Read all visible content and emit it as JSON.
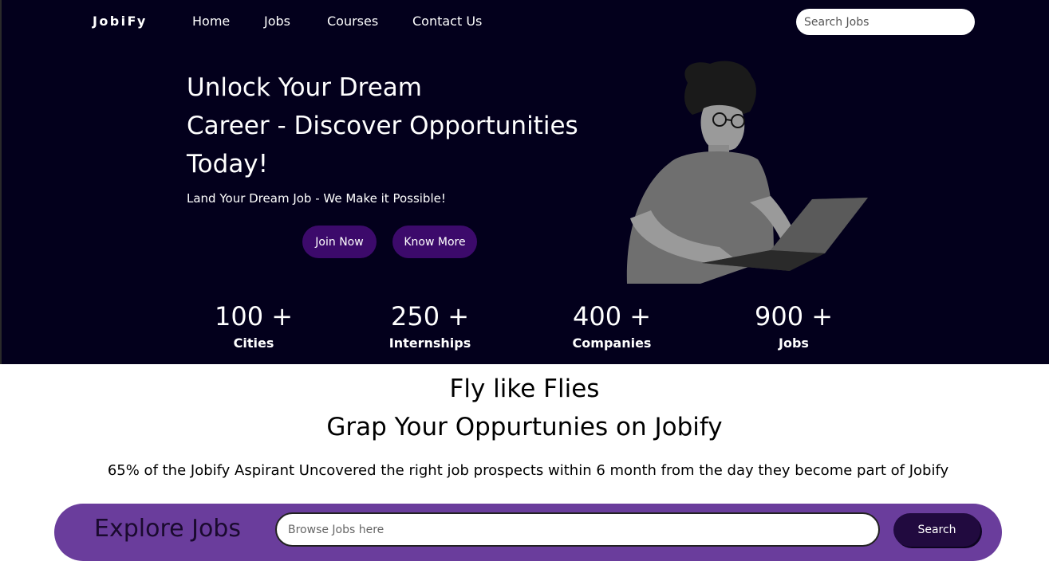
{
  "nav": {
    "logo": "JobiFy",
    "links": [
      "Home",
      "Jobs",
      "Courses",
      "Contact Us"
    ],
    "search_placeholder": "Search Jobs"
  },
  "hero": {
    "title_lines": [
      "Unlock Your Dream",
      "Career - Discover Opportunities",
      "Today!"
    ],
    "subtitle": "Land Your Dream Job - We Make it Possible!",
    "join_label": "Join Now",
    "know_label": "Know More"
  },
  "stats": [
    {
      "number": "100 +",
      "label": "Cities"
    },
    {
      "number": "250 +",
      "label": "Internships"
    },
    {
      "number": "400 +",
      "label": "Companies"
    },
    {
      "number": "900 +",
      "label": "Jobs"
    }
  ],
  "about": {
    "line1": "Fly like Flies",
    "line2": "Grap Your Oppurtunies on Jobify",
    "stat_text": "65% of the Jobify Aspirant Uncovered the right job prospects within 6 month from the day they become part of Jobify"
  },
  "explore": {
    "title": "Explore Jobs",
    "input_placeholder": "Browse Jobs here",
    "search_label": "Search"
  },
  "colors": {
    "hero_bg": "#03001c",
    "button_bg": "#3c0a6b",
    "explore_bar": "#6a3d9c",
    "search_button": "#210a3f"
  }
}
